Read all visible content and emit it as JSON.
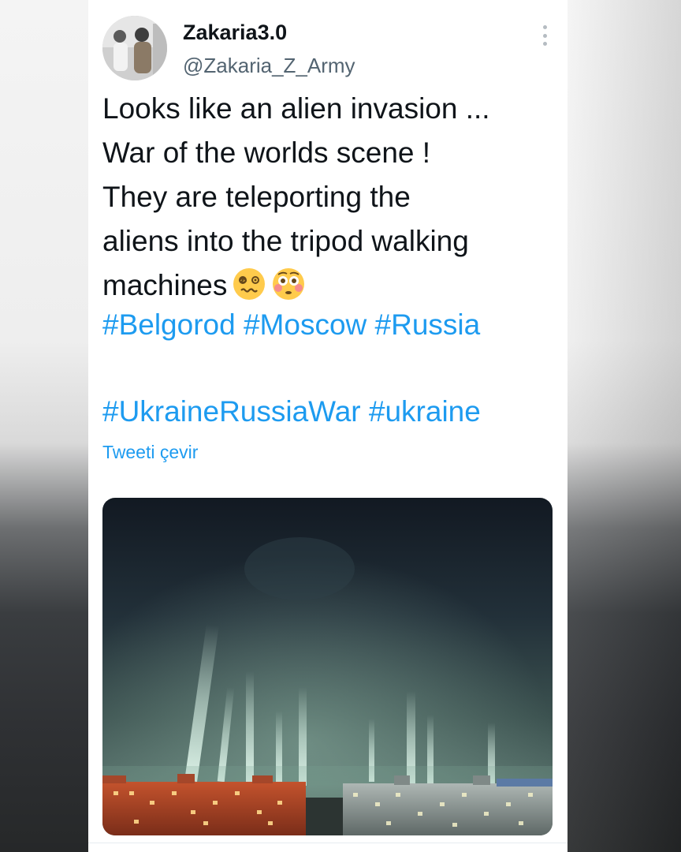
{
  "tweet": {
    "author": {
      "display_name": "Zakaria3.0",
      "handle": "@Zakaria_Z_Army"
    },
    "text_lines": [
      "Looks like an alien invasion ...",
      "War of the worlds scene !",
      "They are teleporting the",
      "aliens into the tripod walking",
      "machines"
    ],
    "emojis": [
      "dizzy-face-icon",
      "flushed-face-icon"
    ],
    "hashtags_line1": [
      "#Belgorod",
      "#Moscow",
      "#Russia"
    ],
    "hashtags_line2": [
      "#UkraineRussiaWar",
      "#ukraine"
    ],
    "translate_label": "Tweeti çevir"
  },
  "colors": {
    "link": "#1d9bf0",
    "text": "#0f1419",
    "secondary": "#536471"
  }
}
